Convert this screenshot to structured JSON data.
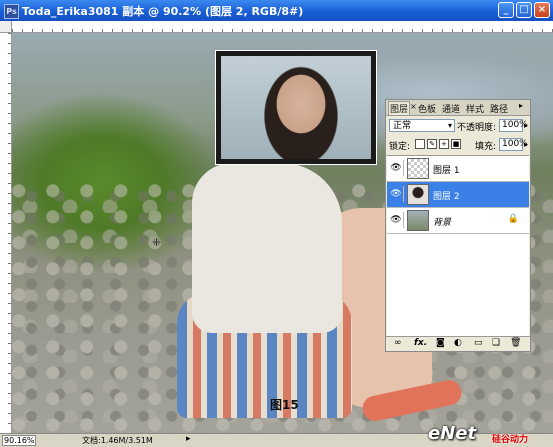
{
  "window": {
    "title": "Toda_Erika3081 副本 @ 90.2% (图层 2, RGB/8#)",
    "app_icon": "Ps",
    "controls": {
      "minimize": "_",
      "maximize": "□",
      "close": "×"
    }
  },
  "canvas": {
    "figure_label": "图15",
    "cursor_glyph": "⁜"
  },
  "layers_panel": {
    "tabs": [
      "图层",
      "通道",
      "路径"
    ],
    "tab_menu_glyph": "▸",
    "tab_extra": [
      "色板",
      "样式"
    ],
    "tab_close": "×",
    "blend_mode": "正常",
    "opacity_label": "不透明度:",
    "opacity_value": "100%",
    "lock_label": "锁定:",
    "fill_label": "填充:",
    "fill_value": "100%",
    "layers": [
      {
        "name": "图层 1",
        "visible": true,
        "selected": false
      },
      {
        "name": "图层 2",
        "visible": true,
        "selected": true
      },
      {
        "name": "背景",
        "visible": true,
        "selected": false,
        "locked": true
      }
    ],
    "bottom_icons": [
      "link-icon",
      "fx-icon",
      "mask-icon",
      "adjustment-icon",
      "group-icon",
      "new-layer-icon",
      "trash-icon"
    ]
  },
  "statusbar": {
    "zoom": "90.16%",
    "doc_info": "文档:1.46M/3.51M",
    "arrow": "▸"
  },
  "watermark": {
    "main": "eNet",
    "sub": "硅谷动力"
  },
  "colors": {
    "titlebar": "#1a5fd6",
    "selected_layer": "#3b80e6",
    "panel_bg": "#ece9d8"
  }
}
